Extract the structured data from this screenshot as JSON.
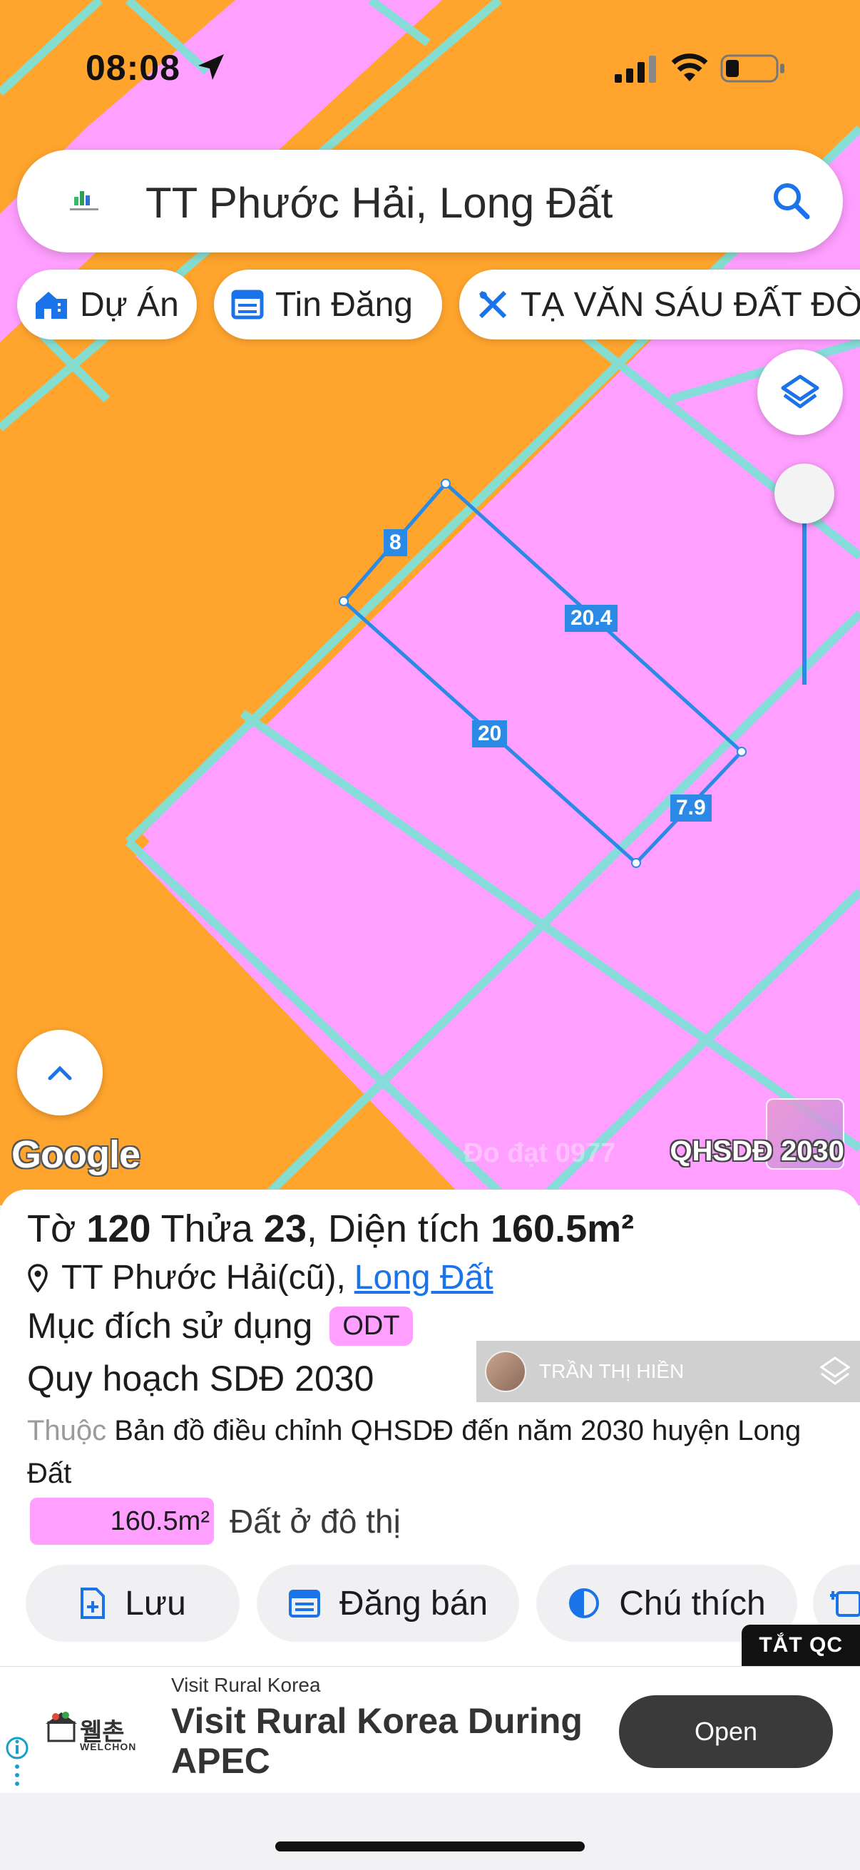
{
  "status_bar": {
    "time": "08:08"
  },
  "search": {
    "query": "TT Phước Hải, Long Đất"
  },
  "chips": [
    {
      "label": "Dự Án",
      "icon": "home-building-icon"
    },
    {
      "label": "Tin Đăng",
      "icon": "listing-icon"
    },
    {
      "label": "TẠ VĂN SÁU ĐẤT ĐÒ",
      "icon": "ruler-pencil-icon"
    }
  ],
  "map": {
    "parcel_edges": [
      "8",
      "20.4",
      "20",
      "7.9"
    ],
    "google_label": "Google",
    "plan_label": "QHSDĐ 2030",
    "watermark": "Đo đạt 0977",
    "colors": {
      "residential": "#ff9fff",
      "other": "#ffa52e",
      "road": "#7fe0d8",
      "boundary": "#2b8ae6"
    }
  },
  "parcel": {
    "title_prefix": "Tờ",
    "sheet": "120",
    "plot_prefix": "Thửa",
    "plot": "23",
    "area_prefix": ", Diện tích",
    "area": "160.5m²",
    "address": "TT Phước Hải(cũ),",
    "address_link": "Long Đất",
    "purpose_label": "Mục đích sử dụng",
    "purpose_code": "ODT",
    "plan_label": "Quy hoạch SDĐ 2030",
    "belongs_prefix": "Thuộc",
    "belongs_text": "Bản đồ điều chỉnh QHSDĐ đến năm 2030 huyện Long Đất",
    "legend_area": "160.5m²",
    "legend_label": "Đất ở đô thị"
  },
  "user_tag": {
    "name": "TRẦN THỊ HIỀN"
  },
  "actions": [
    {
      "label": "Lưu",
      "icon": "save-file-icon"
    },
    {
      "label": "Đăng bán",
      "icon": "calendar-post-icon"
    },
    {
      "label": "Chú thích",
      "icon": "legend-contrast-icon"
    },
    {
      "label": "",
      "icon": "add-calendar-icon"
    }
  ],
  "ad": {
    "close_label": "TẮT QC",
    "sponsor": "Visit Rural Korea",
    "headline": "Visit Rural Korea During APEC",
    "cta": "Open",
    "logo_text": "웰촌",
    "logo_sub": "WELCHON"
  }
}
